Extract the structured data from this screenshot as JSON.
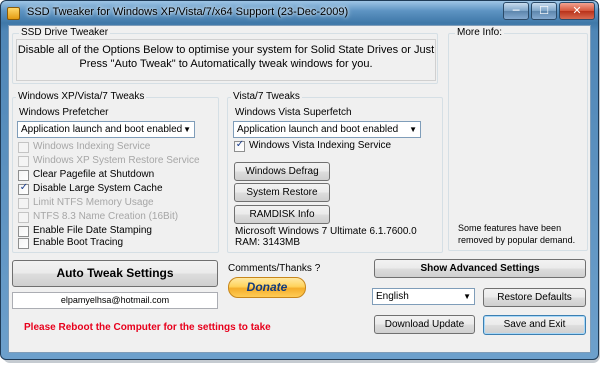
{
  "window": {
    "title": "SSD Tweaker for Windows XP/Vista/7/x64 Support (23-Dec-2009)",
    "min_glyph": "─",
    "max_glyph": "☐",
    "close_glyph": "✕"
  },
  "header_group": {
    "title": "SSD Drive Tweaker",
    "description_line1": "Disable all of the Options Below to optimise your system for Solid State Drives or Just",
    "description_line2": "Press \"Auto Tweak\" to Automatically tweak windows for you."
  },
  "more_info": {
    "title": "More Info:",
    "note_line1": "Some features have been",
    "note_line2": "removed by popular demand."
  },
  "xp_group": {
    "title": "Windows XP/Vista/7 Tweaks",
    "prefetcher_label": "Windows Prefetcher",
    "prefetcher_value": "Application launch and boot enabled",
    "options": [
      {
        "label": "Windows Indexing Service",
        "checked": false,
        "enabled": false
      },
      {
        "label": "Windows XP System Restore Service",
        "checked": false,
        "enabled": false
      },
      {
        "label": "Clear Pagefile at Shutdown",
        "checked": false,
        "enabled": true
      },
      {
        "label": "Disable Large System Cache",
        "checked": true,
        "enabled": true
      },
      {
        "label": "Limit NTFS Memory Usage",
        "checked": false,
        "enabled": false
      },
      {
        "label": "NTFS 8.3 Name Creation (16Bit)",
        "checked": false,
        "enabled": false
      },
      {
        "label": "Enable File Date Stamping",
        "checked": false,
        "enabled": true
      },
      {
        "label": "Enable Boot Tracing",
        "checked": false,
        "enabled": true
      }
    ]
  },
  "vista_group": {
    "title": "Vista/7 Tweaks",
    "superfetch_label": "Windows Vista Superfetch",
    "superfetch_value": "Application launch and boot enabled",
    "indexing_label": "Windows Vista Indexing Service",
    "indexing_checked": true,
    "defrag_button": "Windows Defrag",
    "restore_button": "System Restore",
    "ramdisk_button": "RAMDISK Info",
    "system_info": "Microsoft Windows 7 Ultimate  6.1.7600.0",
    "ram_info": "RAM: 3143MB"
  },
  "bottom": {
    "auto_tweak": "Auto Tweak Settings",
    "email": "elpamyelhsa@hotmail.com",
    "comments": "Comments/Thanks ?",
    "donate": "Donate",
    "reboot_notice": "Please Reboot the Computer for the settings to take",
    "advanced": "Show Advanced Settings",
    "language": "English",
    "restore_defaults": "Restore Defaults",
    "download_update": "Download Update",
    "save_exit": "Save and Exit"
  },
  "colors": {
    "reboot_notice": "#e8001c",
    "title_bar": "#4f86b6",
    "check_mark": "#1a3d8c"
  }
}
